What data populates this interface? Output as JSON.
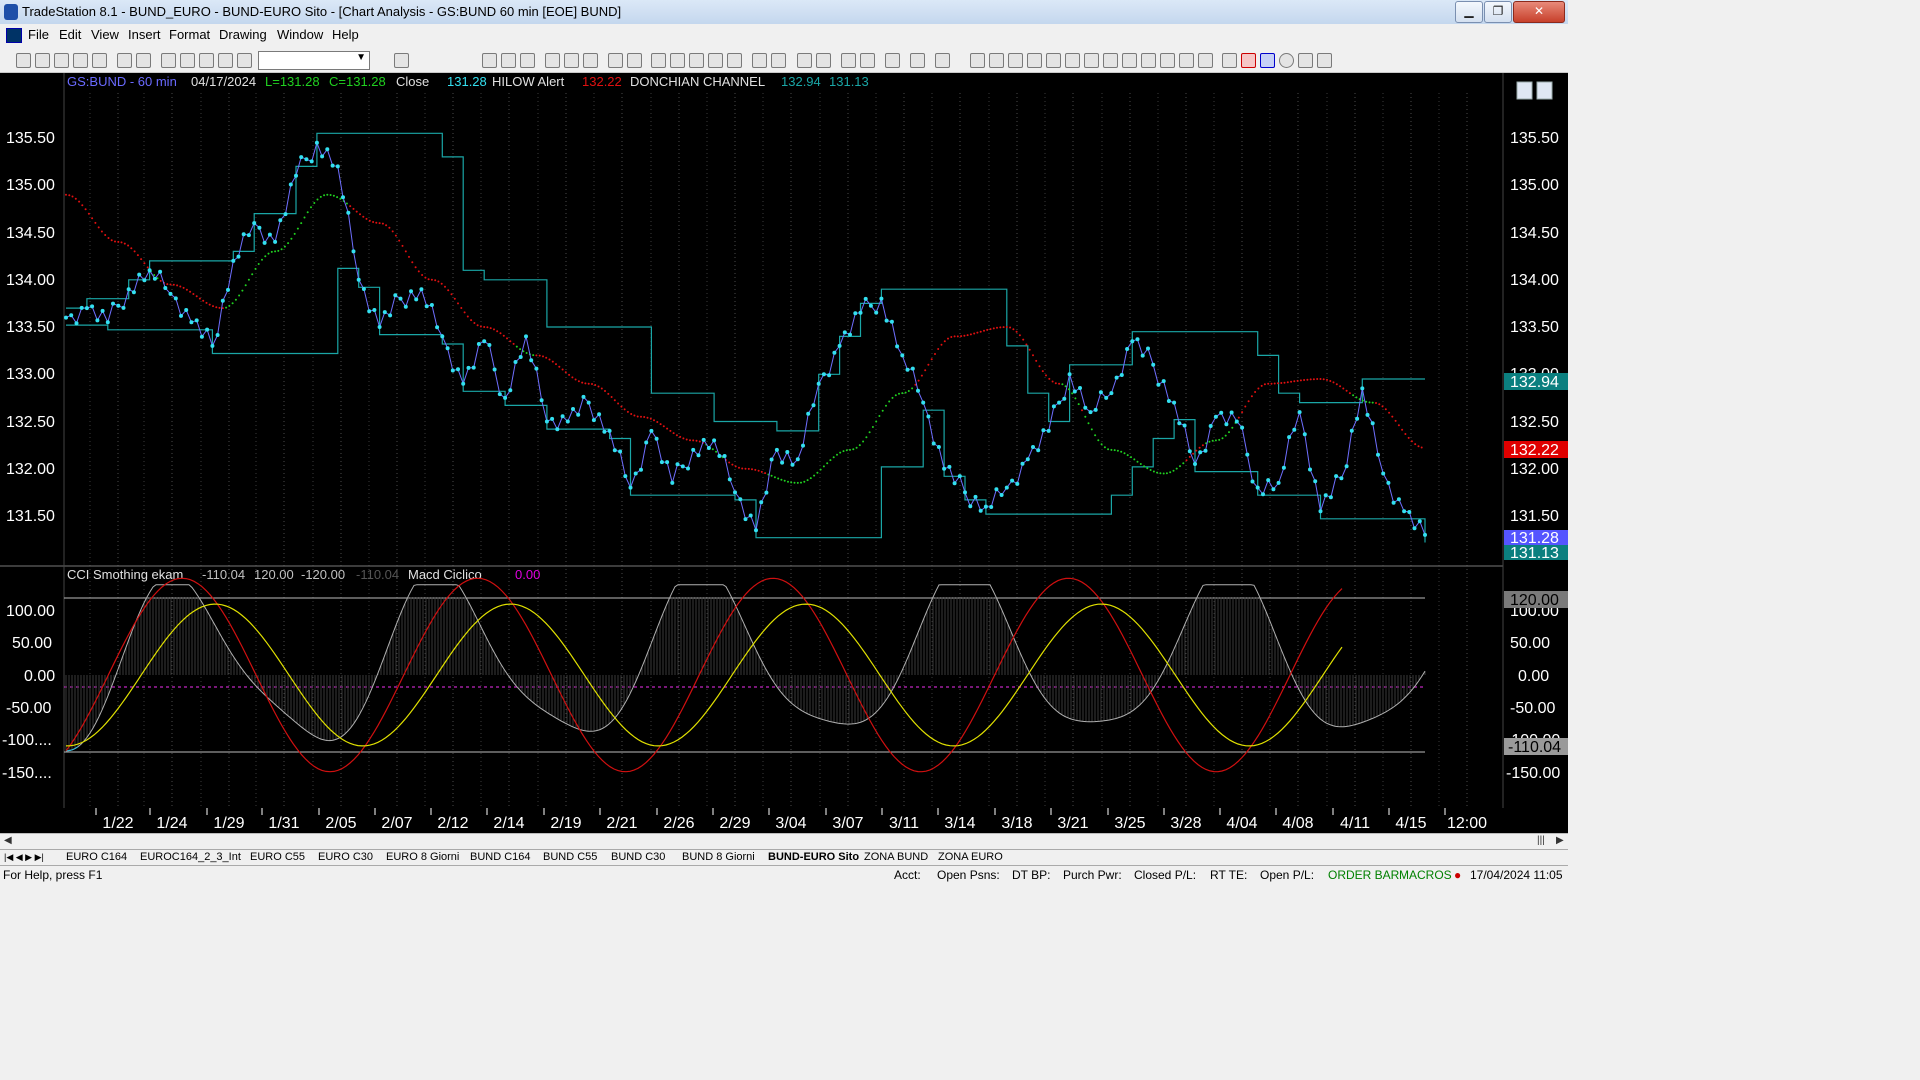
{
  "window": {
    "title": "TradeStation 8.1 - BUND_EURO - BUND-EURO Sito - [Chart Analysis - GS:BUND  60 min  [EOE] BUND]",
    "minimize_label": "▁",
    "restore_label": "❐",
    "close_label": "✕"
  },
  "menu": [
    "File",
    "Edit",
    "View",
    "Insert",
    "Format",
    "Drawing",
    "Window",
    "Help"
  ],
  "mdi_buttons": [
    "–",
    "▫",
    "✕"
  ],
  "chart_header": {
    "symbol": "GS:BUND - 60 min",
    "date": "04/17/2024",
    "low": "L=131.28",
    "close": "C=131.28",
    "close_label": "Close",
    "close_value": "131.28",
    "hilow_label": "HILOW Alert",
    "hilow_value": "132.22",
    "donchian_label": "DONCHIAN CHANNEL",
    "donchian_upper": "132.94",
    "donchian_lower": "131.13"
  },
  "price_axis": {
    "ticks": [
      "135.50",
      "135.00",
      "134.50",
      "134.00",
      "133.50",
      "133.00",
      "132.50",
      "132.00",
      "131.50"
    ],
    "badges": [
      {
        "text": "132.94",
        "bg": "#0b7f7f",
        "fg": "#ffffff"
      },
      {
        "text": "132.22",
        "bg": "#e00000",
        "fg": "#ffffff"
      },
      {
        "text": "131.28",
        "bg": "#5555ff",
        "fg": "#ffffff"
      },
      {
        "text": "131.13",
        "bg": "#0b7f7f",
        "fg": "#ffffff"
      }
    ],
    "hidden_label": "133.00"
  },
  "indicator_header": {
    "name": "CCI Smothing ekam",
    "v1": "-110.04",
    "v2": "120.00",
    "v3": "-120.00",
    "v4": "-110.04",
    "macd_label": "Macd Ciclico",
    "macd_value": "0.00"
  },
  "indicator_axis": {
    "ticks": [
      "100.00",
      "50.00",
      "0.00",
      "-50.00",
      "-100....",
      "-150...."
    ],
    "right_ticks": [
      "100.00",
      "50.00",
      "0.00",
      "-50.00",
      "-100.00",
      "-150.00"
    ],
    "badges": [
      {
        "text": "120.00",
        "bg": "#7a7a7a",
        "fg": "#000000"
      },
      {
        "text": "-110.04",
        "bg": "#9a9a9a",
        "fg": "#000000"
      }
    ]
  },
  "time_axis": [
    "1/22",
    "1/24",
    "1/29",
    "1/31",
    "2/05",
    "2/07",
    "2/12",
    "2/14",
    "2/19",
    "2/21",
    "2/26",
    "2/29",
    "3/04",
    "3/07",
    "3/11",
    "3/14",
    "3/18",
    "3/21",
    "3/25",
    "3/28",
    "4/04",
    "4/08",
    "4/11",
    "4/15",
    "12:00"
  ],
  "tabs": [
    "EURO C164",
    "EUROC164_2_3_Int",
    "EURO C55",
    "EURO C30",
    "EURO 8 Giorni",
    "BUND C164",
    "BUND C55",
    "BUND  C30",
    "BUND 8 Giorni",
    "BUND-EURO Sito",
    "ZONA BUND",
    "ZONA EURO"
  ],
  "selected_tab": "BUND-EURO Sito",
  "status": {
    "help": "For Help, press F1",
    "acct": "Acct:",
    "open_psns": "Open Psns:",
    "dt_bp": "DT BP:",
    "purch_pwr": "Purch Pwr:",
    "closed_pl": "Closed P/L:",
    "rt_te": "RT TE:",
    "open_pl": "Open P/L:",
    "order_bar": "ORDER BAR",
    "macros": "MACROS",
    "datetime": "17/04/2024 11:05"
  },
  "colors": {
    "price": "#33e0f0",
    "donchian": "#1aa6a6",
    "hilow_red": "#e01010",
    "hilow_green": "#20d020",
    "cci": "#9a9a9a",
    "macd_red": "#d01010",
    "macd_yellow": "#e0e000",
    "zero_line": "#a020a0",
    "grid": "#555555"
  },
  "chart_data": {
    "type": "line",
    "title": "GS:BUND - 60 min",
    "ylim": [
      131.0,
      135.8
    ],
    "x_labels": [
      "1/22",
      "1/24",
      "1/29",
      "1/31",
      "2/05",
      "2/07",
      "2/12",
      "2/14",
      "2/19",
      "2/21",
      "2/26",
      "2/29",
      "3/04",
      "3/07",
      "3/11",
      "3/14",
      "3/18",
      "3/21",
      "3/25",
      "3/28",
      "4/04",
      "4/08",
      "4/11",
      "4/15",
      "12:00"
    ],
    "series": [
      {
        "name": "Close",
        "values": [
          133.6,
          133.7,
          133.55,
          133.9,
          134.1,
          133.85,
          133.55,
          133.3,
          134.2,
          134.6,
          134.4,
          135.1,
          135.45,
          135.2,
          134.0,
          133.5,
          133.8,
          133.9,
          133.4,
          132.9,
          133.35,
          132.75,
          133.4,
          132.5,
          132.5,
          132.7,
          132.4,
          131.8,
          132.4,
          131.85,
          132.2,
          132.3,
          131.75,
          131.35,
          132.2,
          132.1,
          132.9,
          133.3,
          133.65,
          133.8,
          133.2,
          132.7,
          132.0,
          131.75,
          131.6,
          131.8,
          132.1,
          132.4,
          133.0,
          132.6,
          132.8,
          133.35,
          133.1,
          132.7,
          132.05,
          132.55,
          132.5,
          131.8,
          131.85,
          132.6,
          131.55,
          131.9,
          132.85,
          131.95,
          131.55,
          131.3
        ]
      },
      {
        "name": "HILOW Alert",
        "values": [
          134.9,
          134.4,
          133.95,
          133.7,
          134.3,
          134.9,
          134.6,
          134.0,
          133.5,
          133.2,
          132.9,
          132.55,
          132.3,
          132.0,
          131.85,
          132.2,
          132.8,
          133.4,
          133.5,
          132.9,
          132.2,
          131.95,
          132.3,
          132.9,
          132.95,
          132.7,
          132.22
        ]
      }
    ]
  }
}
